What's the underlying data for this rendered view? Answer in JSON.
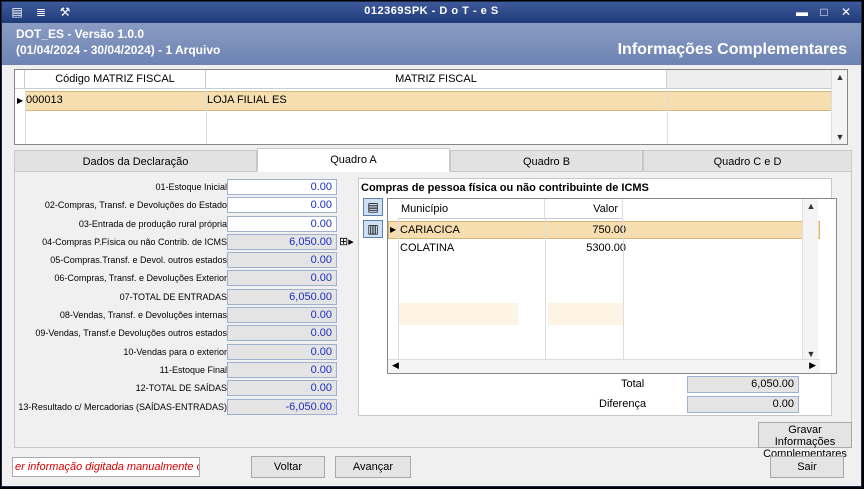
{
  "titlebar": {
    "title": "012369SPK - D o T - e S"
  },
  "header": {
    "line1": "DOT_ES - Versão 1.0.0",
    "line2": "(01/04/2024 - 30/04/2024) - 1 Arquivo",
    "right": "Informações Complementares"
  },
  "matriz": {
    "col1": "Código MATRIZ FISCAL",
    "col2": "MATRIZ FISCAL",
    "row": {
      "code": "000013",
      "name": "LOJA FILIAL ES"
    }
  },
  "tabs": [
    "Dados da Declaração",
    "Quadro A",
    "Quadro B",
    "Quadro C e D"
  ],
  "fields": [
    {
      "label": "01-Estoque Inicial",
      "value": "0.00"
    },
    {
      "label": "02-Compras, Transf. e Devoluções do Estado",
      "value": "0.00"
    },
    {
      "label": "03-Entrada de produção rural própria",
      "value": "0.00"
    },
    {
      "label": "04-Compras P.Física ou não Contrib. de ICMS",
      "value": "6,050.00"
    },
    {
      "label": "05-Compras.Transf. e Devol. outros estados",
      "value": "0.00"
    },
    {
      "label": "06-Compras, Transf. e Devoluções Exterior",
      "value": "0.00"
    },
    {
      "label": "07-TOTAL DE ENTRADAS",
      "value": "6,050.00"
    },
    {
      "label": "08-Vendas, Transf. e Devoluções internas",
      "value": "0.00"
    },
    {
      "label": "09-Vendas, Transf.e Devoluções outros estados",
      "value": "0.00"
    },
    {
      "label": "10-Vendas para o exterior",
      "value": "0.00"
    },
    {
      "label": "11-Estoque Final",
      "value": "0.00"
    },
    {
      "label": "12-TOTAL DE SAÍDAS",
      "value": "0.00"
    },
    {
      "label": "13-Resultado c/ Mercadorias (SAÍDAS-ENTRADAS)",
      "value": "-6,050.00"
    }
  ],
  "compras": {
    "caption": "Compras de pessoa física ou não contribuinte de ICMS",
    "h_municipio": "Município",
    "h_valor": "Valor",
    "rows": [
      {
        "municipio": "CARIACICA",
        "valor": "750.00"
      },
      {
        "municipio": "COLATINA",
        "valor": "5300.00"
      }
    ],
    "total_label": "Total",
    "total": "6,050.00",
    "dif_label": "Diferença",
    "dif": "0.00"
  },
  "buttons": {
    "gravar": "Gravar Informações Complementares",
    "voltar": "Voltar",
    "avancar": "Avançar",
    "sair": "Sair"
  },
  "status": "er informação digitada manualmente ou in"
}
